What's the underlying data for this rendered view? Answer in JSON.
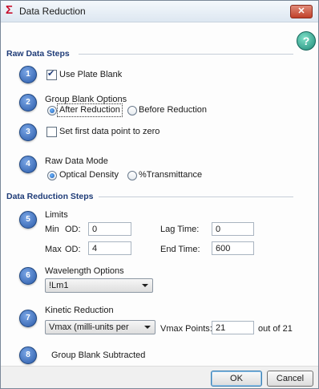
{
  "window": {
    "title": "Data Reduction",
    "title_icon": "Σ",
    "close_label": "✕",
    "help_label": "?"
  },
  "sections": {
    "raw": "Raw Data Steps",
    "reduction": "Data Reduction Steps"
  },
  "steps": {
    "s1": {
      "num": "1",
      "label": "Use Plate Blank",
      "checked": true
    },
    "s2": {
      "num": "2",
      "title": "Group Blank Options",
      "opt1": "After Reduction",
      "opt2": "Before Reduction",
      "selected": "After Reduction"
    },
    "s3": {
      "num": "3",
      "label": "Set first data point to zero",
      "checked": false
    },
    "s4": {
      "num": "4",
      "title": "Raw Data Mode",
      "opt1": "Optical Density",
      "opt2": "%Transmittance",
      "selected": "Optical Density"
    },
    "s5": {
      "num": "5",
      "title": "Limits",
      "min_label": "Min",
      "max_label": "Max",
      "od_label": "OD:",
      "min_od": "0",
      "max_od": "4",
      "lag_label": "Lag Time:",
      "lag_value": "0",
      "end_label": "End Time:",
      "end_value": "600"
    },
    "s6": {
      "num": "6",
      "title": "Wavelength Options",
      "selected": "!Lm1"
    },
    "s7": {
      "num": "7",
      "title": "Kinetic Reduction",
      "selected": "Vmax (milli-units per",
      "points_label": "Vmax Points:",
      "points_value": "21",
      "out_of": "out of 21"
    },
    "s8": {
      "num": "8",
      "title": "Group Blank Subtracted"
    }
  },
  "buttons": {
    "ok": "OK",
    "cancel": "Cancel"
  },
  "colors": {
    "accent": "#1f3c78",
    "badge": "#2a5aa8"
  }
}
